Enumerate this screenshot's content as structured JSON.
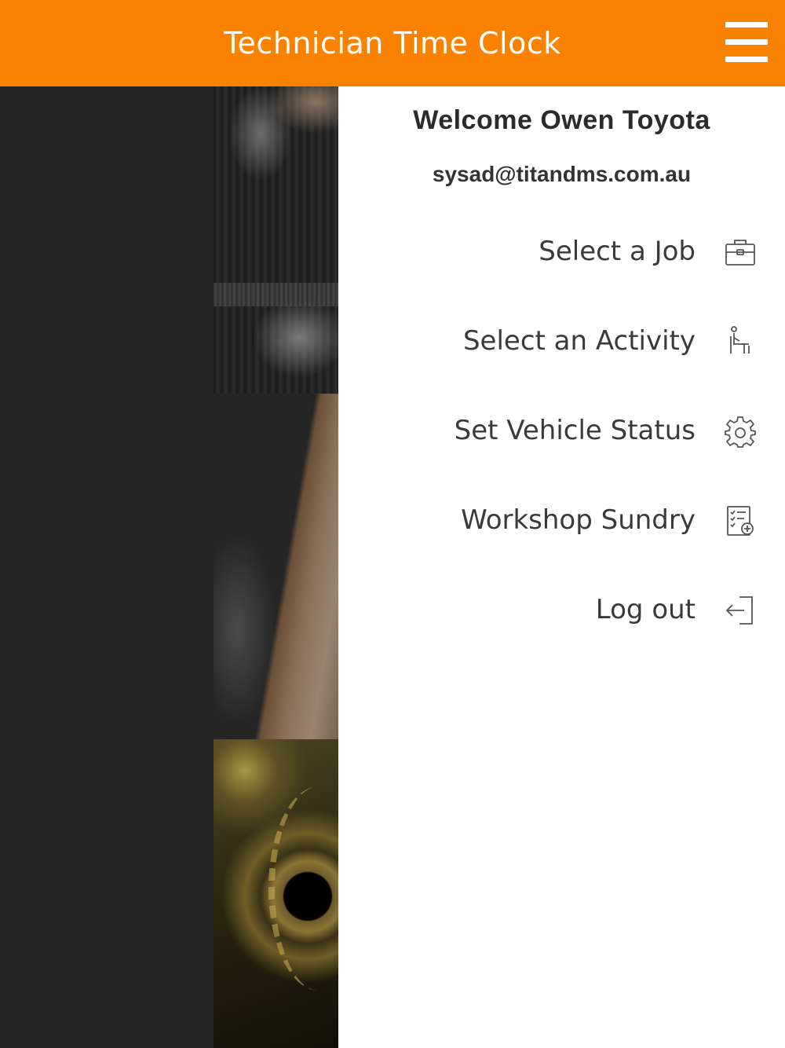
{
  "header": {
    "title": "Technician Time Clock",
    "menu_icon": "hamburger-menu-icon",
    "background_color": "#fb8100"
  },
  "drawer": {
    "welcome": "Welcome Owen Toyota",
    "email": "sysad@titandms.com.au",
    "items": [
      {
        "label": "Select a Job",
        "icon": "toolbox-icon"
      },
      {
        "label": "Select an Activity",
        "icon": "person-sitting-icon"
      },
      {
        "label": "Set Vehicle Status",
        "icon": "gear-icon"
      },
      {
        "label": "Workshop Sundry",
        "icon": "checklist-add-icon"
      },
      {
        "label": "Log out",
        "icon": "logout-icon"
      }
    ]
  }
}
